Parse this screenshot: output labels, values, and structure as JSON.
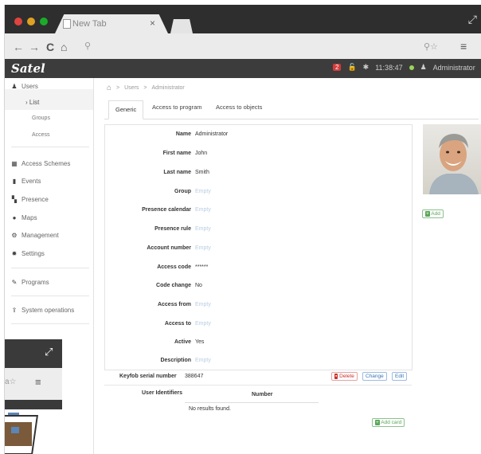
{
  "browser": {
    "tab_title": "New Tab",
    "tab_close": "×",
    "nav_back": "←",
    "nav_forward": "→",
    "nav_reload": "C",
    "nav_home": "⌂",
    "omnibox_icon": "⚲",
    "zoom_icons": "⚲☆",
    "menu": "≡",
    "traffic_colors": [
      "#e0443e",
      "#dea123",
      "#1aab29"
    ]
  },
  "app": {
    "brand": "Satel",
    "header": {
      "badge": "2",
      "time": "11:38:47",
      "user": "Administrator"
    }
  },
  "sidebar": {
    "users": "Users",
    "list": "List",
    "groups": "Groups",
    "access": "Access",
    "items": [
      {
        "label": "Access Schemes",
        "icon": "calendar-icon"
      },
      {
        "label": "Events",
        "icon": "events-icon"
      },
      {
        "label": "Presence",
        "icon": "presence-icon"
      },
      {
        "label": "Maps",
        "icon": "map-pin-icon"
      },
      {
        "label": "Management",
        "icon": "cogs-icon"
      },
      {
        "label": "Settings",
        "icon": "gear-icon"
      }
    ],
    "programs": "Programs",
    "system_operations": "System operations"
  },
  "breadcrumb": {
    "sep": ">",
    "users": "Users",
    "current": "Administrator"
  },
  "tabs": [
    "Generic",
    "Access to program",
    "Access to objects"
  ],
  "form": {
    "fields": [
      {
        "label": "Name",
        "value": "Administrator",
        "empty": false
      },
      {
        "label": "First name",
        "value": "John",
        "empty": false
      },
      {
        "label": "Last name",
        "value": "Smith",
        "empty": false
      },
      {
        "label": "Group",
        "value": "Empty",
        "empty": true
      },
      {
        "label": "Presence calendar",
        "value": "Empty",
        "empty": true
      },
      {
        "label": "Presence rule",
        "value": "Empty",
        "empty": true
      },
      {
        "label": "Account number",
        "value": "Empty",
        "empty": true
      },
      {
        "label": "Access code",
        "value": "******",
        "empty": false
      },
      {
        "label": "Code change",
        "value": "No",
        "empty": false
      },
      {
        "label": "Access from",
        "value": "Empty",
        "empty": true
      },
      {
        "label": "Access to",
        "value": "Empty",
        "empty": true
      },
      {
        "label": "Active",
        "value": "Yes",
        "empty": false
      },
      {
        "label": "Description",
        "value": "Empty",
        "empty": true
      }
    ]
  },
  "photo_add": "Add",
  "keyfob": {
    "label": "Keyfob serial number",
    "value": "388647",
    "delete": "Delete",
    "change": "Change",
    "edit": "Edit"
  },
  "identifiers": {
    "label": "User Identifiers",
    "column": "Number",
    "empty": "No results found.",
    "add_card": "Add card"
  },
  "colors": {
    "header_bg": "#3c3c3c",
    "empty_value": "#b8cde3",
    "delete_red": "#c9302c",
    "link_blue": "#3a73b8",
    "add_green": "#5aa55a"
  }
}
